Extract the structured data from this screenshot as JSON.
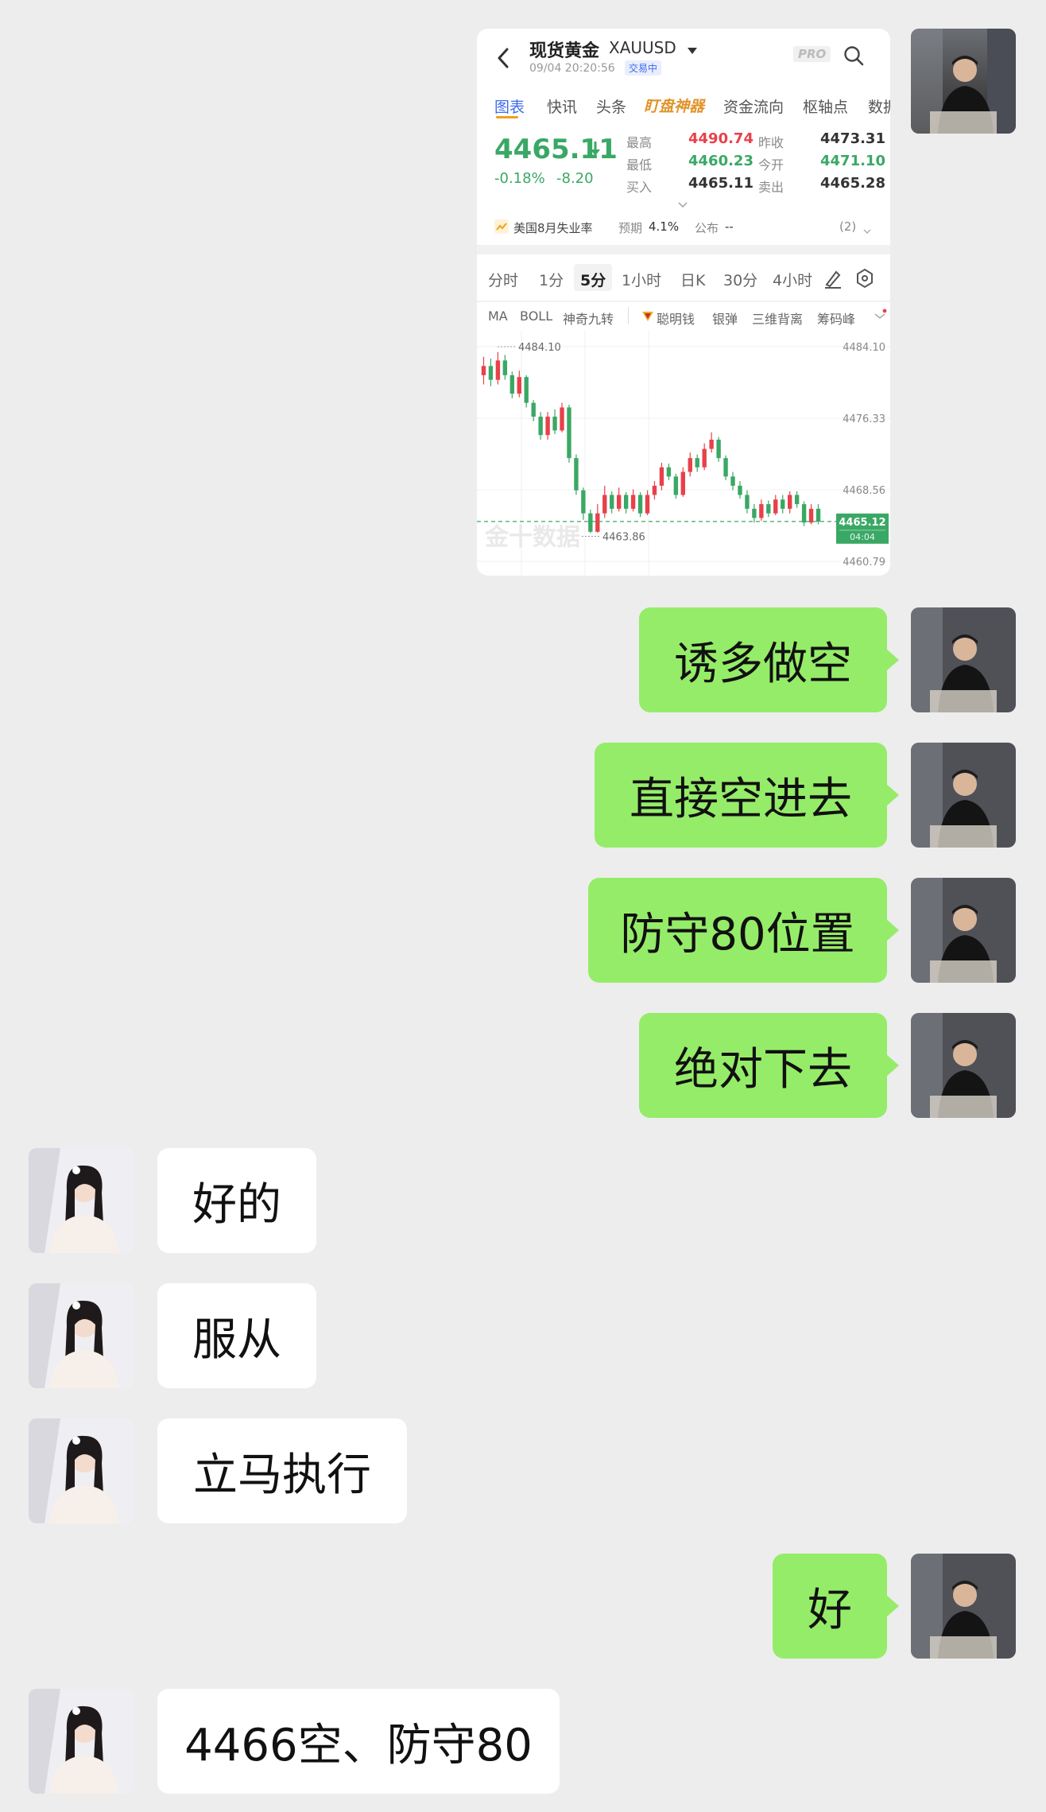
{
  "chart_card": {
    "title": "现货黄金",
    "symbol": "XAUUSD",
    "timestamp": "09/04 20:20:56",
    "status_badge": "交易中",
    "pro_badge": "PRO",
    "tabs": [
      "图表",
      "快讯",
      "头条",
      "盯盘神器",
      "资金流向",
      "枢轴点",
      "数据"
    ],
    "price": "4465.11",
    "change_pct": "-0.18%",
    "change_abs": "-8.20",
    "stats": {
      "high_label": "最高",
      "high": "4490.74",
      "low_label": "最低",
      "low": "4460.23",
      "bid_label": "买入",
      "bid": "4465.11",
      "prev_close_label": "昨收",
      "prev_close": "4473.31",
      "open_label": "今开",
      "open": "4471.10",
      "ask_label": "卖出",
      "ask": "4465.28"
    },
    "event": {
      "name": "美国8月失业率",
      "forecast_label": "预期",
      "forecast": "4.1%",
      "actual_label": "公布",
      "actual": "--",
      "count": "(2)"
    },
    "periods": [
      "分时",
      "1分",
      "5分",
      "1小时",
      "日K",
      "30分",
      "4小时"
    ],
    "active_period": "5分",
    "indicators": [
      "MA",
      "BOLL",
      "神奇九转",
      "聪明钱",
      "银弹",
      "三维背离",
      "筹码峰"
    ],
    "watermark": "金十数据",
    "colors": {
      "up": "#e8414a",
      "down": "#3aa865",
      "accent": "#3d6cf0"
    }
  },
  "chart_data": {
    "type": "candlestick",
    "interval": "5分",
    "y_ticks": [
      "4484.10",
      "4476.33",
      "4468.56",
      "4460.79"
    ],
    "ylim": [
      4460.79,
      4484.1
    ],
    "high_marker": "4484.10",
    "low_marker": "4463.86",
    "current_price": "4465.12",
    "countdown": "04:04",
    "candles": [
      {
        "o": 4481,
        "c": 4482,
        "h": 4483,
        "l": 4480
      },
      {
        "o": 4482,
        "c": 4480.5,
        "h": 4482.8,
        "l": 4479.8
      },
      {
        "o": 4480.5,
        "c": 4482.6,
        "h": 4483.5,
        "l": 4480
      },
      {
        "o": 4482.6,
        "c": 4481,
        "h": 4483.2,
        "l": 4480.5
      },
      {
        "o": 4481,
        "c": 4479,
        "h": 4481.4,
        "l": 4478.5
      },
      {
        "o": 4479,
        "c": 4480.8,
        "h": 4481.5,
        "l": 4478.6
      },
      {
        "o": 4480.8,
        "c": 4478,
        "h": 4481,
        "l": 4477.5
      },
      {
        "o": 4478,
        "c": 4476.5,
        "h": 4478.3,
        "l": 4476
      },
      {
        "o": 4476.5,
        "c": 4474.5,
        "h": 4477,
        "l": 4474
      },
      {
        "o": 4474.5,
        "c": 4476.5,
        "h": 4477,
        "l": 4474
      },
      {
        "o": 4476.5,
        "c": 4475,
        "h": 4477.3,
        "l": 4474.6
      },
      {
        "o": 4475,
        "c": 4477.5,
        "h": 4478,
        "l": 4474.8
      },
      {
        "o": 4477.5,
        "c": 4472,
        "h": 4477.8,
        "l": 4471.5
      },
      {
        "o": 4472,
        "c": 4468.5,
        "h": 4472.4,
        "l": 4468
      },
      {
        "o": 4468.5,
        "c": 4466,
        "h": 4468.8,
        "l": 4465.3
      },
      {
        "o": 4466,
        "c": 4464,
        "h": 4466.4,
        "l": 4463.86
      },
      {
        "o": 4464,
        "c": 4466,
        "h": 4467,
        "l": 4463.9
      },
      {
        "o": 4466,
        "c": 4468,
        "h": 4469,
        "l": 4465.5
      },
      {
        "o": 4468,
        "c": 4466.5,
        "h": 4468.4,
        "l": 4466
      },
      {
        "o": 4466.5,
        "c": 4468,
        "h": 4468.8,
        "l": 4466.2
      },
      {
        "o": 4468,
        "c": 4466.5,
        "h": 4468.3,
        "l": 4466
      },
      {
        "o": 4466.5,
        "c": 4468,
        "h": 4468.6,
        "l": 4466.2
      },
      {
        "o": 4468,
        "c": 4466,
        "h": 4468.3,
        "l": 4465.6
      },
      {
        "o": 4466,
        "c": 4468,
        "h": 4468.5,
        "l": 4465.8
      },
      {
        "o": 4468,
        "c": 4469,
        "h": 4469.5,
        "l": 4467.5
      },
      {
        "o": 4469,
        "c": 4471,
        "h": 4471.5,
        "l": 4468.5
      },
      {
        "o": 4471,
        "c": 4470,
        "h": 4471.4,
        "l": 4469.6
      },
      {
        "o": 4470,
        "c": 4468,
        "h": 4470.3,
        "l": 4467.6
      },
      {
        "o": 4468,
        "c": 4470.5,
        "h": 4471,
        "l": 4467.8
      },
      {
        "o": 4470.5,
        "c": 4472,
        "h": 4472.6,
        "l": 4470
      },
      {
        "o": 4472,
        "c": 4471,
        "h": 4472.4,
        "l": 4470.5
      },
      {
        "o": 4471,
        "c": 4473,
        "h": 4473.6,
        "l": 4470.7
      },
      {
        "o": 4473,
        "c": 4474,
        "h": 4474.8,
        "l": 4472.6
      },
      {
        "o": 4474,
        "c": 4472,
        "h": 4474.3,
        "l": 4471.6
      },
      {
        "o": 4472,
        "c": 4470,
        "h": 4472.3,
        "l": 4469.6
      },
      {
        "o": 4470,
        "c": 4469,
        "h": 4470.5,
        "l": 4468.5
      },
      {
        "o": 4469,
        "c": 4468,
        "h": 4469.5,
        "l": 4467.6
      },
      {
        "o": 4468,
        "c": 4466.5,
        "h": 4468.5,
        "l": 4466
      },
      {
        "o": 4466.5,
        "c": 4465.5,
        "h": 4467,
        "l": 4465
      },
      {
        "o": 4465.5,
        "c": 4467,
        "h": 4467.5,
        "l": 4465.2
      },
      {
        "o": 4467,
        "c": 4466,
        "h": 4467.4,
        "l": 4465.6
      },
      {
        "o": 4466,
        "c": 4467.5,
        "h": 4468,
        "l": 4465.8
      },
      {
        "o": 4467.5,
        "c": 4466.5,
        "h": 4468,
        "l": 4466
      },
      {
        "o": 4466.5,
        "c": 4468,
        "h": 4468.4,
        "l": 4466
      },
      {
        "o": 4468,
        "c": 4467,
        "h": 4468.4,
        "l": 4466.6
      },
      {
        "o": 4467,
        "c": 4465,
        "h": 4467.3,
        "l": 4464.6
      },
      {
        "o": 4465,
        "c": 4466.5,
        "h": 4467,
        "l": 4464.8
      },
      {
        "o": 4466.5,
        "c": 4465.1,
        "h": 4467,
        "l": 4464.8
      }
    ]
  },
  "messages": [
    {
      "side": "out",
      "text": "诱多做空"
    },
    {
      "side": "out",
      "text": "直接空进去"
    },
    {
      "side": "out",
      "text": "防守80位置"
    },
    {
      "side": "out",
      "text": "绝对下去"
    },
    {
      "side": "in",
      "text": "好的"
    },
    {
      "side": "in",
      "text": "服从"
    },
    {
      "side": "in",
      "text": "立马执行"
    },
    {
      "side": "out",
      "text": "好"
    },
    {
      "side": "in",
      "text": "4466空、防守80"
    }
  ]
}
